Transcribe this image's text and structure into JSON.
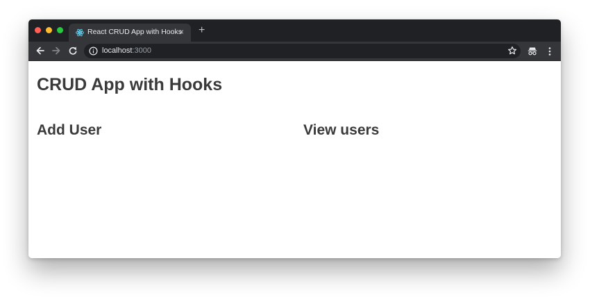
{
  "browser": {
    "tab_title": "React CRUD App with Hooks",
    "tab_close": "×",
    "new_tab": "+",
    "url_host": "localhost",
    "url_port": ":3000",
    "icons": {
      "favicon": "react-icon",
      "back": "back-arrow-icon",
      "forward": "forward-arrow-icon",
      "reload": "reload-icon",
      "site_info": "info-icon",
      "bookmark": "star-icon",
      "incognito": "incognito-icon",
      "menu": "kebab-menu-icon"
    },
    "colors": {
      "frame": "#202124",
      "toolbar": "#35363a",
      "close": "#ff5f57",
      "minimize": "#febc2e",
      "maximize": "#28c840"
    }
  },
  "page": {
    "title": "CRUD App with Hooks",
    "add_user_heading": "Add User",
    "view_users_heading": "View users"
  }
}
